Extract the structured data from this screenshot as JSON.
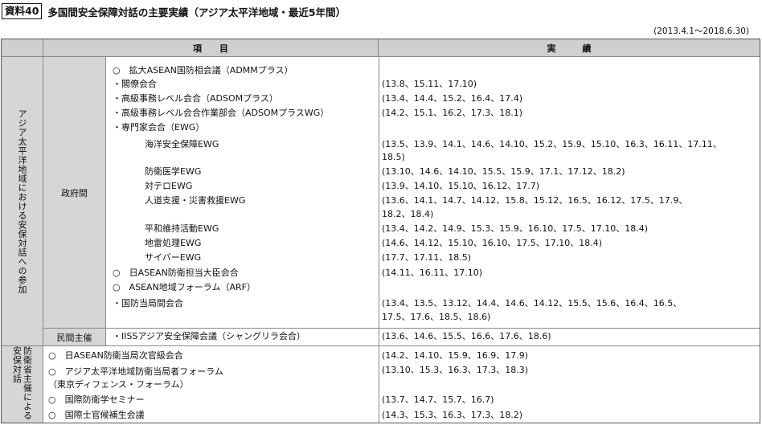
{
  "doc": {
    "label": "資料40",
    "title": "多国間安全保障対話の主要実績（アジア太平洋地域・最近5年間）",
    "period": "(2013.4.1〜2018.6.30)"
  },
  "table": {
    "header_item": "項　　目",
    "header_result": "実　　　績",
    "section1_label": "アジア太平洋地域における安保対話への参加",
    "gov_label": "政府間",
    "private_label": "民間主催",
    "section2_label": "防衛省主催による安保対話",
    "gov_items": [
      "○　拡大ASEAN国防相会議（ADMMプラス）",
      "・閣僚会合",
      "・高級事務レベル会合（ADSOMプラス）",
      "・高級事務レベル会合作業部会（ADSOMプラスWG）",
      "・専門家会合（EWG）",
      "海洋安全保障EWG",
      "防衛医学EWG",
      "対テロEWG",
      "人道支援・災害救援EWG",
      "平和維持活動EWG",
      "地雷処理EWG",
      "サイバーEWG",
      "○　日ASEAN防衛担当大臣会合",
      "○　ASEAN地域フォーラム（ARF）",
      "・国防当局間会合"
    ],
    "gov_results": [
      "(13.8、15.11、17.10)",
      "(13.4、14.4、15.2、16.4、17.4)",
      "(14.2、15.1、16.2、17.3、18.1)",
      "(13.5、13.9、14.1、14.6、14.10、15.2、15.9、15.10、16.3、16.11、17.11、",
      "18.5)",
      "(13.10、14.6、14.10、15.5、15.9、17.1、17.12、18.2)",
      "(13.9、14.10、15.10、16.12、17.7)",
      "(13.6、14.1、14.7、14.12、15.8、15.12、16.5、16.12、17.5、17.9、",
      "18.2、18.4)",
      "(13.4、14.2、14.9、15.3、15.9、16.10、17.5、17.10、18.4)",
      "(14.6、14.12、15.10、16.10、17.5、17.10、18.4)",
      "(17.7、17.11、18.5)",
      "(14.11、16.11、17.10)",
      "(13.4、13.5、13.12、14.4、14.6、14.12、15.5、15.6、16.4、16.5、",
      "17.5、17.6、18.5、18.6)"
    ],
    "private_item": "・IISSアジア安全保障会議（シャングリラ会合）",
    "private_result": "(13.6、14.6、15.5、16.6、17.6、18.6)",
    "mod_items": [
      "○　日ASEAN防衛当局次官級会合",
      "○　アジア太平洋地域防衛当局者フォーラム",
      "（東京ディフェンス・フォーラム）",
      "○　国際防衛学セミナー",
      "○　国際士官候補生会議"
    ],
    "mod_results": [
      "(14.2、14.10、15.9、16.9、17.9)",
      "(13.10、15.3、16.3、17.3、18.3)",
      "(13.7、14.7、15.7、16.7)",
      "(14.3、15.3、16.3、17.3、18.2)"
    ]
  }
}
